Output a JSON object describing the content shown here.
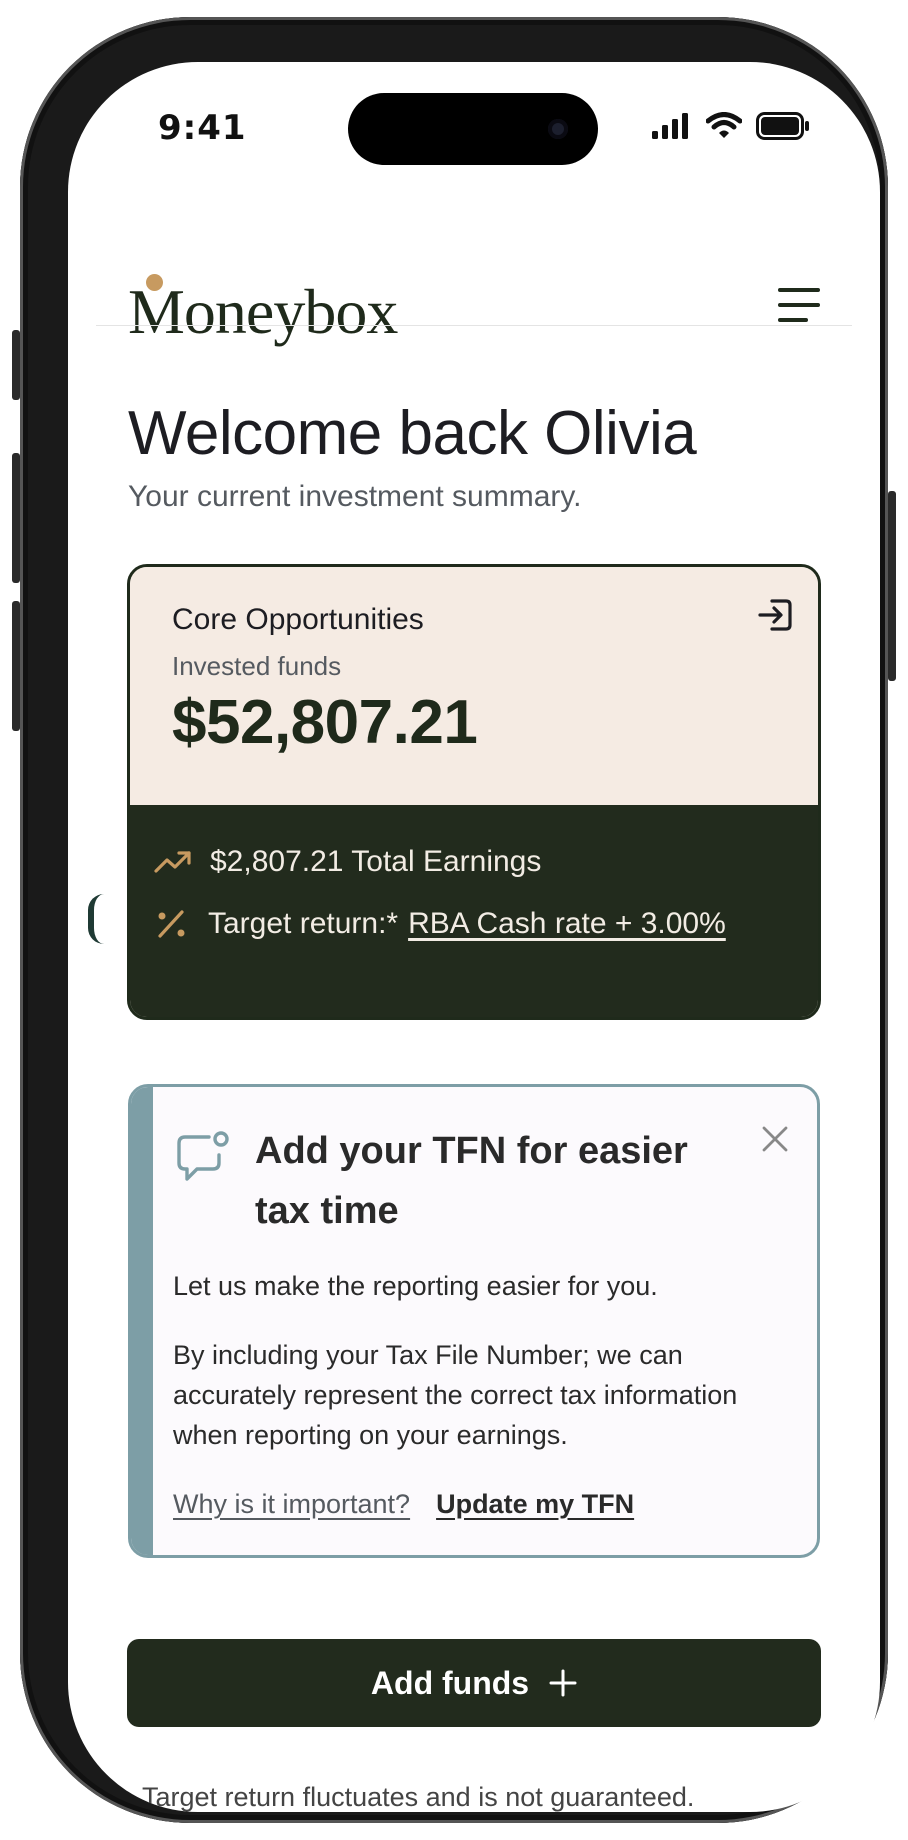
{
  "status_bar": {
    "time": "9:41"
  },
  "header": {
    "logo_text": "Moneybox",
    "menu_icon": "hamburger-menu-icon"
  },
  "welcome": {
    "title": "Welcome back Olivia",
    "subtitle": "Your current investment summary."
  },
  "fund_card": {
    "name": "Core Opportunities",
    "label": "Invested funds",
    "value": "$52,807.21",
    "earnings": "$2,807.21 Total Earnings",
    "target_prefix": "Target return:*",
    "target_link": "RBA Cash rate + 3.00%",
    "accent_color": "#c79a60",
    "top_color": "#f5ebe3",
    "bottom_color": "#222b1d"
  },
  "tfn_card": {
    "title": "Add your TFN for easier tax time",
    "text1": "Let us make the reporting easier for you.",
    "text2": "By including your Tax File Number; we can accurately represent the correct tax information when reporting on your earnings.",
    "link_why": "Why is it important?",
    "link_update": "Update my TFN",
    "accent_color": "#7d9ea6"
  },
  "add_funds": {
    "label": "Add funds"
  },
  "disclaimer": "Target return fluctuates and is not guaranteed."
}
